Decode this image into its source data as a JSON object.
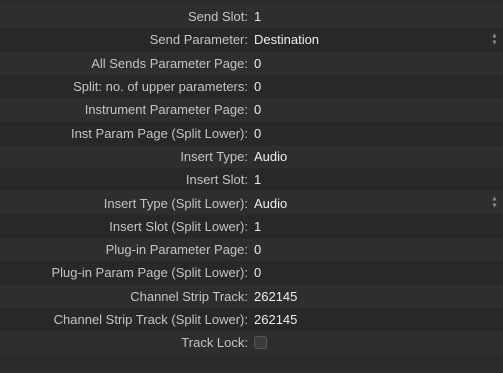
{
  "rows": [
    {
      "label": "Send Slot:",
      "value": "1"
    },
    {
      "label": "Send Parameter:",
      "value": "Destination"
    },
    {
      "label": "All Sends Parameter Page:",
      "value": "0"
    },
    {
      "label": "Split: no. of upper parameters:",
      "value": "0"
    },
    {
      "label": "Instrument Parameter Page:",
      "value": "0"
    },
    {
      "label": "Inst Param Page (Split Lower):",
      "value": "0"
    },
    {
      "label": "Insert Type:",
      "value": "Audio"
    },
    {
      "label": "Insert Slot:",
      "value": "1"
    },
    {
      "label": "Insert Type (Split Lower):",
      "value": "Audio"
    },
    {
      "label": "Insert Slot (Split Lower):",
      "value": "1"
    },
    {
      "label": "Plug-in Parameter Page:",
      "value": "0"
    },
    {
      "label": "Plug-in Param Page (Split Lower):",
      "value": "0"
    },
    {
      "label": "Channel Strip Track:",
      "value": "262145"
    },
    {
      "label": "Channel Strip Track (Split Lower):",
      "value": "262145"
    },
    {
      "label": "Track Lock:",
      "checked": false
    }
  ],
  "icons": {
    "stepper": "up-down-chevron-icon",
    "checkbox": "checkbox-unchecked"
  }
}
